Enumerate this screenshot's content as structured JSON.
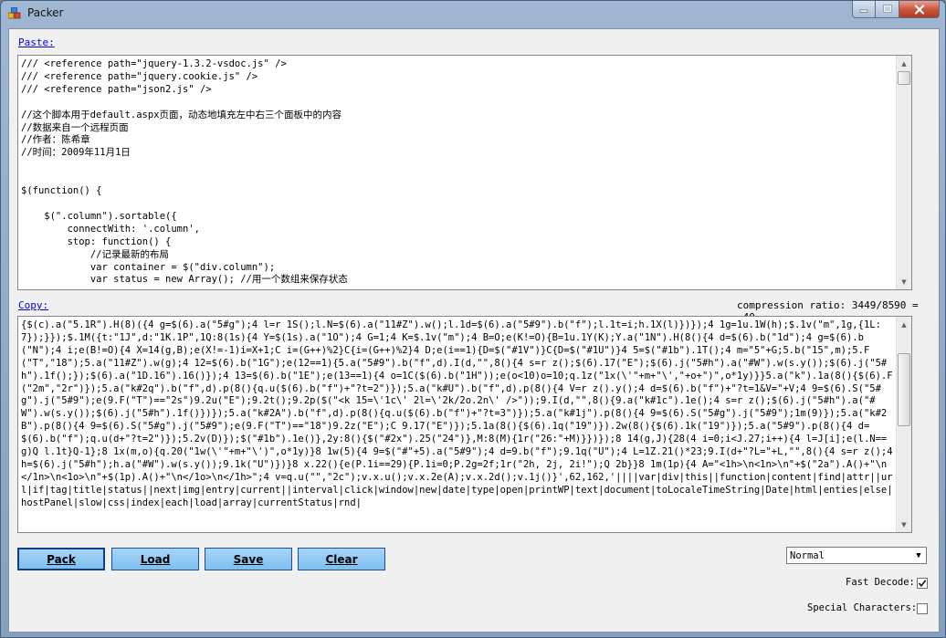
{
  "window": {
    "title": "Packer"
  },
  "paste": {
    "label": "Paste:",
    "lines": [
      "/// <reference path=\"jquery-1.3.2-vsdoc.js\" />",
      "/// <reference path=\"jquery.cookie.js\" />",
      "/// <reference path=\"json2.js\" />",
      "",
      "//这个脚本用于default.aspx页面，动态地填充左中右三个面板中的内容",
      "//数据来自一个远程页面",
      "//作者：陈希章",
      "//时间：2009年11月1日",
      "",
      "",
      "$(function() {",
      "",
      "    $(\".column\").sortable({",
      "        connectWith: '.column',",
      "        stop: function() {",
      "            //记录最新的布局",
      "            var container = $(\"div.column\");",
      "            var status = new Array(); //用一个数组来保存状态"
    ]
  },
  "copy": {
    "label": "Copy:",
    "ratio_text": "compression ratio: 3449/8590 = .40",
    "text": "{$(c).a(\"5.1R\").H(8)({4 g=$(6).a(\"5#g\");4 l=r 1S();l.N=$(6).a(\"11#Z\").w();l.1d=$(6).a(\"5#9\").b(\"f\");l.1t=i;h.1X(l)})});4 1g=1u.1W(h);$.1v(\"m\",1g,{1L:7});}});$.1M({t:\"1J\",d:\"1K.1P\",1Q:8(1s){4 Y=$(1s).a(\"1O\");4 G=1;4 K=$.1v(\"m\");4 B=O;e(K!=O){B=1u.1Y(K);Y.a(\"1N\").H(8(){4 d=$(6).b(\"1d\");4 g=$(6).b(\"N\");4 i;e(B!=O){4 X=14(g,B);e(X!=-1)i=X+1;C i=(G++)%2}C{i=(G++)%2}4 D;e(i==1){D=$(\"#1V\")}C{D=$(\"#1U\")}4 5=$(\"#1b\").1T();4 m=\"5\"+G;5.b(\"15\",m);5.F(\"T\",\"18\");5.a(\"11#Z\").w(g);4 12=$(6).b(\"1G\");e(12==1){5.a(\"5#9\").b(\"f\",d).I(d,\"\",8(){4 s=r z();$(6).17(\"E\");$(6).j(\"5#h\").a(\"#W\").w(s.y());$(6).j(\"5#h\").1f();});$(6).a(\"1D.16\").16()});4 13=$(6).b(\"1E\");e(13==1){4 o=1C($(6).b(\"1H\"));e(o<10)o=10;q.1z(\"1x(\\'\"+m+\"\\',\"+o+\")\",o*1y)}}5.a(\"k\").1a(8(){$(6).F(\"2m\",\"2r\")});5.a(\"k#2q\").b(\"f\",d).p(8(){q.u($(6).b(\"f\")+\"?t=2\")});5.a(\"k#U\").b(\"f\",d).p(8(){4 V=r z().y();4 d=$(6).b(\"f\")+\"?t=1&V=\"+V;4 9=$(6).S(\"5#g\").j(\"5#9\");e(9.F(\"T\")==\"2s\")9.2u(\"E\");9.2t();9.2p($(\"<k 15=\\'1c\\' 2l=\\'2k/2o.2n\\' />\"));9.I(d,\"\",8(){9.a(\"k#1c\").1e();4 s=r z();$(6).j(\"5#h\").a(\"#W\").w(s.y());$(6).j(\"5#h\").1f()})});5.a(\"k#2A\").b(\"f\",d).p(8(){q.u($(6).b(\"f\")+\"?t=3\")});5.a(\"k#1j\").p(8(){4 9=$(6).S(\"5#g\").j(\"5#9\");1m(9)});5.a(\"k#2B\").p(8(){4 9=$(6).S(\"5#g\").j(\"5#9\");e(9.F(\"T\")==\"18\")9.2z(\"E\");C 9.17(\"E\")});5.1a(8(){$(6).1q(\"19\")}).2w(8(){$(6).1k(\"19\")});5.a(\"5#9\").p(8(){4 d=$(6).b(\"f\");q.u(d+\"?t=2\")});5.2v(D)});$(\"#1b\").1e()},2y:8(){$(\"#2x\").25(\"24\")},M:8(M){1r(\"26:\"+M)}})});8 14(g,J){28(4 i=0;i<J.27;i++){4 l=J[i];e(l.N==g)Q l.1t}Q-1};8 1x(m,o){q.20(\"1w(\\'\"+m+\"\\')\",o*1y)}8 1w(5){4 9=$(\"#\"+5).a(\"5#9\");4 d=9.b(\"f\");9.1q(\"U\");4 L=1Z.21()*23;9.I(d+\"?L=\"+L,\"\",8(){4 s=r z();4 h=$(6).j(\"5#h\");h.a(\"#W\").w(s.y());9.1k(\"U\")})}8 x.22(){e(P.1i==29){P.1i=0;P.2g=2f;1r(\"2h, 2j, 2i!\");Q 2b}}8 1m(1p){4 A=\"<1h>\\n<1n>\\n\"+$(\"2a\").A()+\"\\n</1n>\\n<1o>\\n\"+$(1p).A()+\"\\n</1o>\\n</1h>\";4 v=q.u(\"\",\"2c\");v.x.u();v.x.2e(A);v.x.2d();v.1j()}',62,162,'||||var|div|this||function|content|find|attr||url|if|tag|title|status||next|img|entry|current||interval|click|window|new|date|type|open|printWP|text|document|toLocaleTimeString|Date|html|enties|else|hostPanel|slow|css|index|each|load|array|currentStatus|rnd|"
  },
  "buttons": {
    "pack": "Pack",
    "load": "Load",
    "save": "Save",
    "clear": "Clear"
  },
  "options": {
    "encoding_selected": "Normal",
    "fast_decode_label": "Fast Decode:",
    "fast_decode_checked": true,
    "special_chars_label": "Special Characters:",
    "special_chars_checked": false
  }
}
